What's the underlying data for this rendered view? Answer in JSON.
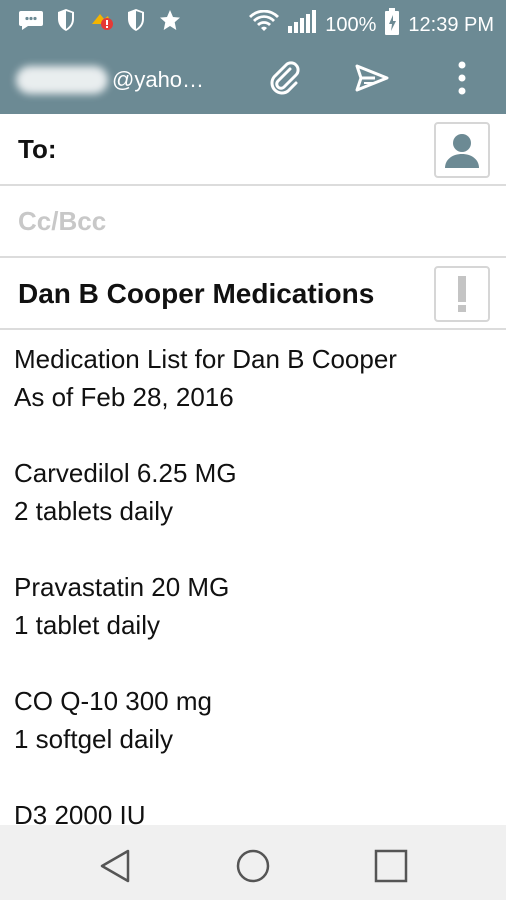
{
  "status_bar": {
    "battery": "100%",
    "time": "12:39 PM",
    "icons": [
      "message-icon",
      "shield-icon",
      "app-notification-icon",
      "shield-icon",
      "star-icon",
      "wifi-icon",
      "signal-icon",
      "battery-charging-icon"
    ]
  },
  "toolbar": {
    "account_suffix": "@yaho…",
    "icons": [
      "attach-icon",
      "send-icon",
      "overflow-menu-icon"
    ]
  },
  "compose": {
    "to_label": "To:",
    "cc_label": "Cc/Bcc",
    "subject": "Dan B Cooper Medications"
  },
  "body_lines": [
    "Medication List for Dan B Cooper",
    "As of Feb 28, 2016",
    "",
    "Carvedilol 6.25 MG",
    "2 tablets daily",
    "",
    "Pravastatin 20 MG",
    "1 tablet daily",
    "",
    "CO Q-10 300 mg",
    "1 softgel daily",
    "",
    "D3 2000 IU"
  ],
  "colors": {
    "header_bg": "#6c8a94",
    "divider": "#dcdcdc",
    "placeholder": "#c8c8c8",
    "nav_bg": "#f0f0f0"
  }
}
